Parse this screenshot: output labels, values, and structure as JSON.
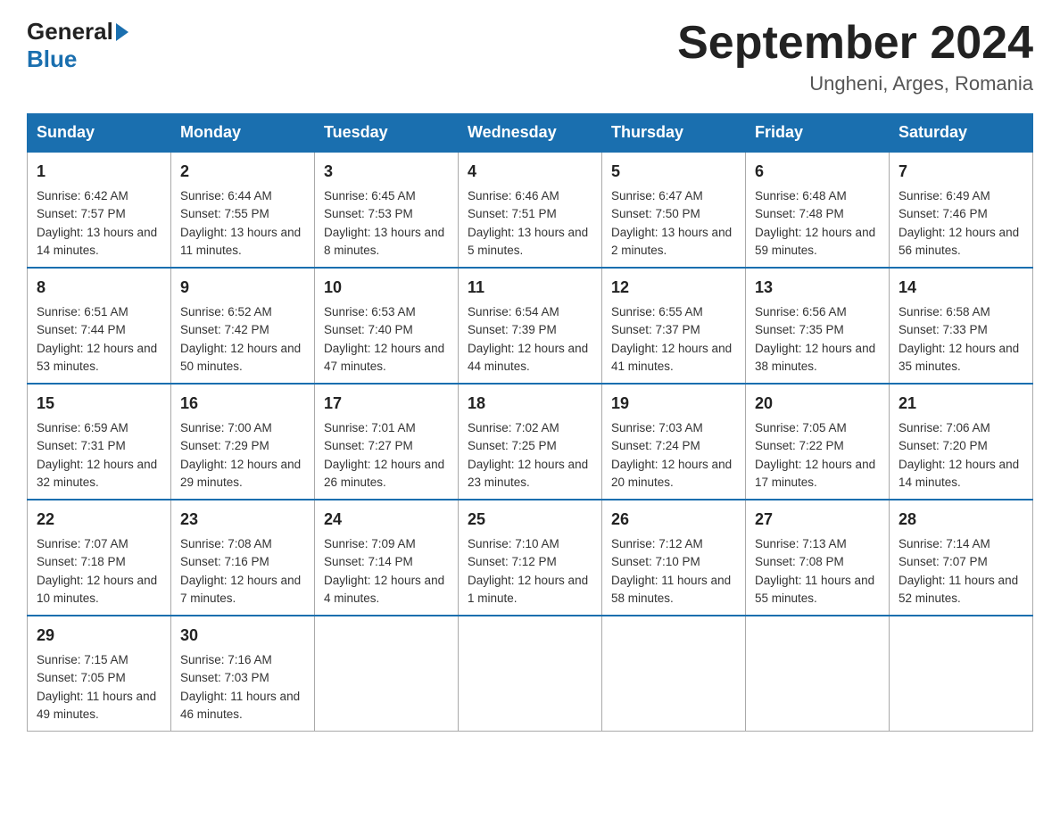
{
  "header": {
    "logo_general": "General",
    "logo_blue": "Blue",
    "title": "September 2024",
    "subtitle": "Ungheni, Arges, Romania"
  },
  "weekdays": [
    "Sunday",
    "Monday",
    "Tuesday",
    "Wednesday",
    "Thursday",
    "Friday",
    "Saturday"
  ],
  "weeks": [
    [
      {
        "day": "1",
        "sunrise": "6:42 AM",
        "sunset": "7:57 PM",
        "daylight": "13 hours and 14 minutes."
      },
      {
        "day": "2",
        "sunrise": "6:44 AM",
        "sunset": "7:55 PM",
        "daylight": "13 hours and 11 minutes."
      },
      {
        "day": "3",
        "sunrise": "6:45 AM",
        "sunset": "7:53 PM",
        "daylight": "13 hours and 8 minutes."
      },
      {
        "day": "4",
        "sunrise": "6:46 AM",
        "sunset": "7:51 PM",
        "daylight": "13 hours and 5 minutes."
      },
      {
        "day": "5",
        "sunrise": "6:47 AM",
        "sunset": "7:50 PM",
        "daylight": "13 hours and 2 minutes."
      },
      {
        "day": "6",
        "sunrise": "6:48 AM",
        "sunset": "7:48 PM",
        "daylight": "12 hours and 59 minutes."
      },
      {
        "day": "7",
        "sunrise": "6:49 AM",
        "sunset": "7:46 PM",
        "daylight": "12 hours and 56 minutes."
      }
    ],
    [
      {
        "day": "8",
        "sunrise": "6:51 AM",
        "sunset": "7:44 PM",
        "daylight": "12 hours and 53 minutes."
      },
      {
        "day": "9",
        "sunrise": "6:52 AM",
        "sunset": "7:42 PM",
        "daylight": "12 hours and 50 minutes."
      },
      {
        "day": "10",
        "sunrise": "6:53 AM",
        "sunset": "7:40 PM",
        "daylight": "12 hours and 47 minutes."
      },
      {
        "day": "11",
        "sunrise": "6:54 AM",
        "sunset": "7:39 PM",
        "daylight": "12 hours and 44 minutes."
      },
      {
        "day": "12",
        "sunrise": "6:55 AM",
        "sunset": "7:37 PM",
        "daylight": "12 hours and 41 minutes."
      },
      {
        "day": "13",
        "sunrise": "6:56 AM",
        "sunset": "7:35 PM",
        "daylight": "12 hours and 38 minutes."
      },
      {
        "day": "14",
        "sunrise": "6:58 AM",
        "sunset": "7:33 PM",
        "daylight": "12 hours and 35 minutes."
      }
    ],
    [
      {
        "day": "15",
        "sunrise": "6:59 AM",
        "sunset": "7:31 PM",
        "daylight": "12 hours and 32 minutes."
      },
      {
        "day": "16",
        "sunrise": "7:00 AM",
        "sunset": "7:29 PM",
        "daylight": "12 hours and 29 minutes."
      },
      {
        "day": "17",
        "sunrise": "7:01 AM",
        "sunset": "7:27 PM",
        "daylight": "12 hours and 26 minutes."
      },
      {
        "day": "18",
        "sunrise": "7:02 AM",
        "sunset": "7:25 PM",
        "daylight": "12 hours and 23 minutes."
      },
      {
        "day": "19",
        "sunrise": "7:03 AM",
        "sunset": "7:24 PM",
        "daylight": "12 hours and 20 minutes."
      },
      {
        "day": "20",
        "sunrise": "7:05 AM",
        "sunset": "7:22 PM",
        "daylight": "12 hours and 17 minutes."
      },
      {
        "day": "21",
        "sunrise": "7:06 AM",
        "sunset": "7:20 PM",
        "daylight": "12 hours and 14 minutes."
      }
    ],
    [
      {
        "day": "22",
        "sunrise": "7:07 AM",
        "sunset": "7:18 PM",
        "daylight": "12 hours and 10 minutes."
      },
      {
        "day": "23",
        "sunrise": "7:08 AM",
        "sunset": "7:16 PM",
        "daylight": "12 hours and 7 minutes."
      },
      {
        "day": "24",
        "sunrise": "7:09 AM",
        "sunset": "7:14 PM",
        "daylight": "12 hours and 4 minutes."
      },
      {
        "day": "25",
        "sunrise": "7:10 AM",
        "sunset": "7:12 PM",
        "daylight": "12 hours and 1 minute."
      },
      {
        "day": "26",
        "sunrise": "7:12 AM",
        "sunset": "7:10 PM",
        "daylight": "11 hours and 58 minutes."
      },
      {
        "day": "27",
        "sunrise": "7:13 AM",
        "sunset": "7:08 PM",
        "daylight": "11 hours and 55 minutes."
      },
      {
        "day": "28",
        "sunrise": "7:14 AM",
        "sunset": "7:07 PM",
        "daylight": "11 hours and 52 minutes."
      }
    ],
    [
      {
        "day": "29",
        "sunrise": "7:15 AM",
        "sunset": "7:05 PM",
        "daylight": "11 hours and 49 minutes."
      },
      {
        "day": "30",
        "sunrise": "7:16 AM",
        "sunset": "7:03 PM",
        "daylight": "11 hours and 46 minutes."
      },
      {
        "day": "",
        "sunrise": "",
        "sunset": "",
        "daylight": ""
      },
      {
        "day": "",
        "sunrise": "",
        "sunset": "",
        "daylight": ""
      },
      {
        "day": "",
        "sunrise": "",
        "sunset": "",
        "daylight": ""
      },
      {
        "day": "",
        "sunrise": "",
        "sunset": "",
        "daylight": ""
      },
      {
        "day": "",
        "sunrise": "",
        "sunset": "",
        "daylight": ""
      }
    ]
  ],
  "labels": {
    "sunrise_prefix": "Sunrise: ",
    "sunset_prefix": "Sunset: ",
    "daylight_prefix": "Daylight: "
  }
}
